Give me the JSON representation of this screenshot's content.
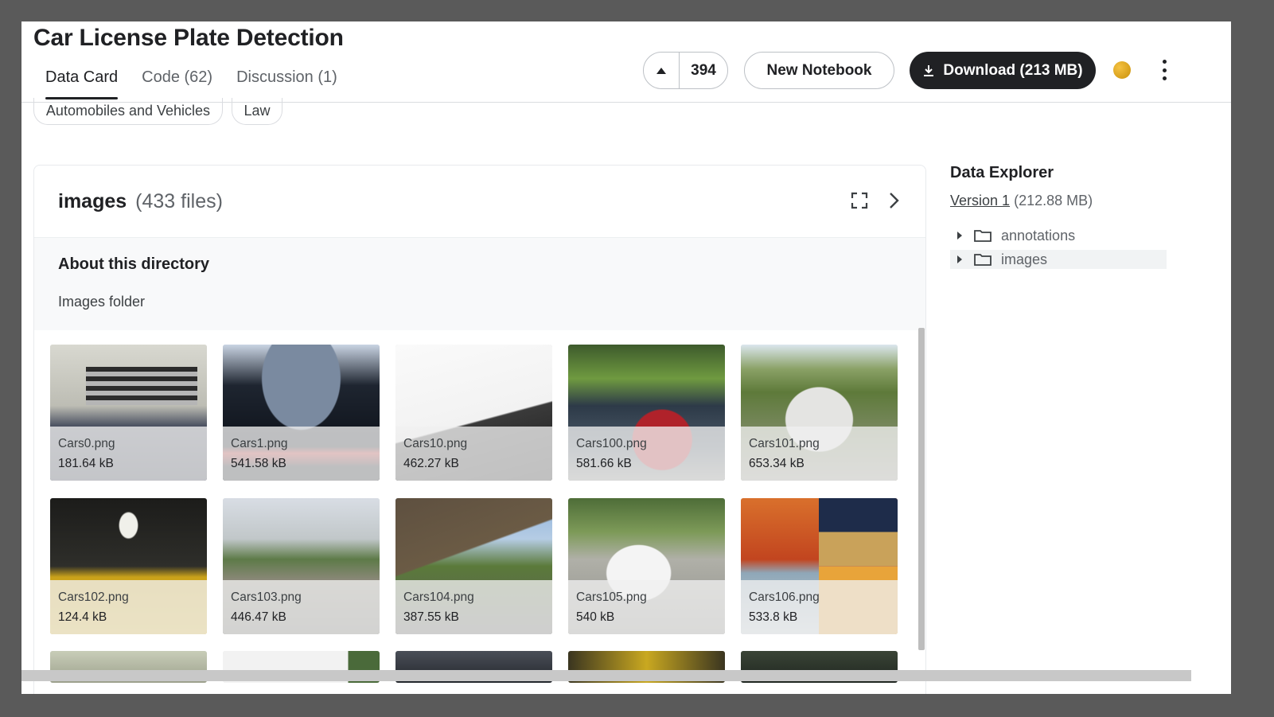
{
  "header": {
    "title": "Car License Plate Detection",
    "tabs": [
      {
        "label": "Data Card",
        "active": true
      },
      {
        "label": "Code (62)",
        "active": false
      },
      {
        "label": "Discussion (1)",
        "active": false
      }
    ],
    "vote_count": "394",
    "new_notebook_label": "New Notebook",
    "download_label": "Download (213 MB)"
  },
  "tags": [
    "Automobiles and Vehicles",
    "Law"
  ],
  "directory": {
    "name": "images",
    "count": "(433 files)",
    "about_title": "About this directory",
    "about_desc": "Images folder"
  },
  "files": [
    {
      "name": "Cars0.png",
      "size": "181.64 kB"
    },
    {
      "name": "Cars1.png",
      "size": "541.58 kB"
    },
    {
      "name": "Cars10.png",
      "size": "462.27 kB"
    },
    {
      "name": "Cars100.png",
      "size": "581.66 kB"
    },
    {
      "name": "Cars101.png",
      "size": "653.34 kB"
    },
    {
      "name": "Cars102.png",
      "size": "124.4 kB"
    },
    {
      "name": "Cars103.png",
      "size": "446.47 kB"
    },
    {
      "name": "Cars104.png",
      "size": "387.55 kB"
    },
    {
      "name": "Cars105.png",
      "size": "540 kB"
    },
    {
      "name": "Cars106.png",
      "size": "533.8 kB"
    }
  ],
  "sidebar": {
    "title": "Data Explorer",
    "version_link": "Version 1",
    "version_size": "(212.88 MB)",
    "tree": [
      {
        "label": "annotations",
        "selected": false
      },
      {
        "label": "images",
        "selected": true
      }
    ]
  },
  "colors": {
    "accent_dark": "#202124",
    "medal": "#e0a81c"
  }
}
